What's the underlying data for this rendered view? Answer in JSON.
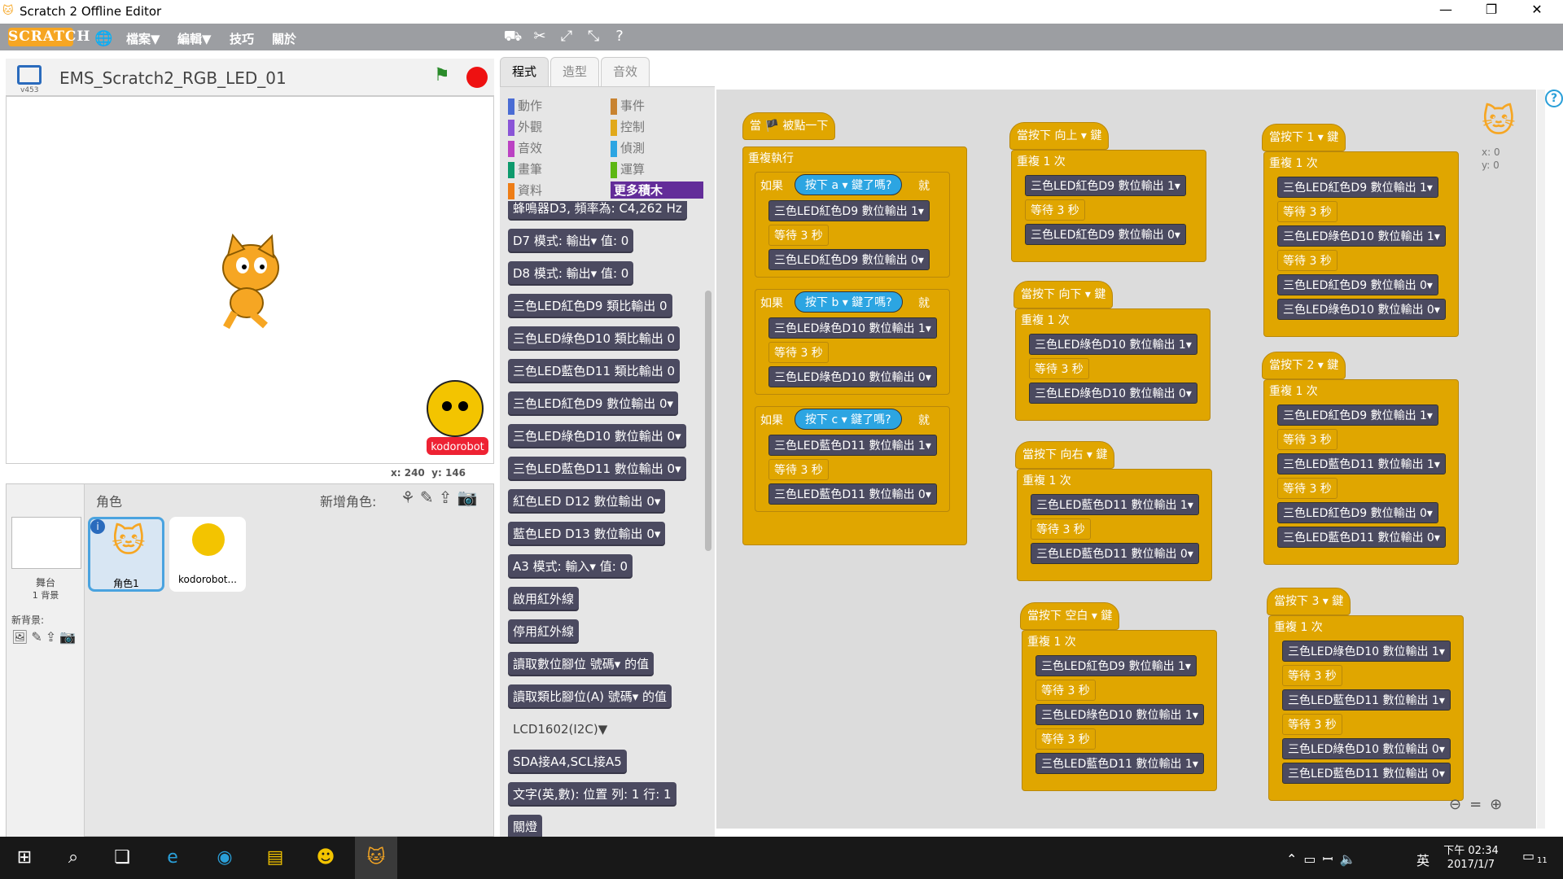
{
  "window": {
    "title": "Scratch 2 Offline Editor"
  },
  "menu": {
    "file": "檔案▼",
    "edit": "編輯▼",
    "tips": "技巧",
    "about": "關於"
  },
  "stage": {
    "project_title": "EMS_Scratch2_RGB_LED_01",
    "version": "v453",
    "x_label": "x:",
    "x": "240",
    "y_label": "y:",
    "y": "146"
  },
  "tabs": {
    "scripts": "程式",
    "costumes": "造型",
    "sounds": "音效"
  },
  "categories": [
    {
      "label": "動作",
      "color": "#4a6cd4"
    },
    {
      "label": "事件",
      "color": "#c88330"
    },
    {
      "label": "外觀",
      "color": "#8a55d7"
    },
    {
      "label": "控制",
      "color": "#e1a91a"
    },
    {
      "label": "音效",
      "color": "#bb42c3"
    },
    {
      "label": "偵測",
      "color": "#2ca5e2"
    },
    {
      "label": "畫筆",
      "color": "#0e9a6c"
    },
    {
      "label": "運算",
      "color": "#5cb712"
    },
    {
      "label": "資料",
      "color": "#ee7d16"
    },
    {
      "label": "更多積木",
      "color": "#632d99"
    }
  ],
  "palette_blocks": [
    "蜂鳴器D3, 頻率為: C4,262 Hz",
    "D7 模式: 輸出▾ 值: 0",
    "D8 模式: 輸出▾ 值: 0",
    "三色LED紅色D9 類比輸出 0",
    "三色LED綠色D10 類比輸出 0",
    "三色LED藍色D11 類比輸出 0",
    "三色LED紅色D9 數位輸出 0▾",
    "三色LED綠色D10 數位輸出 0▾",
    "三色LED藍色D11 數位輸出 0▾",
    "紅色LED D12 數位輸出 0▾",
    "藍色LED D13 數位輸出 0▾",
    "A3 模式: 輸入▾ 值: 0",
    "啟用紅外線",
    "停用紅外線",
    "讀取數位腳位 號碼▾ 的值",
    "讀取類比腳位(A) 號碼▾ 的值",
    "LCD1602(I2C)▼",
    "SDA接A4,SCL接A5",
    "文字(英,數): 位置 列: 1 行: 1",
    "關燈"
  ],
  "sprites": {
    "header": "角色",
    "new_sprite": "新增角色:",
    "stage_label": "舞台",
    "backdrops": "1 背景",
    "new_backdrop": "新背景:",
    "items": [
      {
        "name": "角色1"
      },
      {
        "name": "kodorobot..."
      }
    ]
  },
  "scripts": {
    "main": {
      "hat": "當 🏴 被點一下",
      "forever": "重複執行",
      "if1": "如果",
      "key_a": "按下 a ▾ 鍵了嗎?",
      "then": "就",
      "if_rows_a": [
        "三色LED紅色D9 數位輸出 1▾",
        "等待 3 秒",
        "三色LED紅色D9 數位輸出 0▾"
      ],
      "key_b": "按下 b ▾ 鍵了嗎?",
      "if_rows_b": [
        "三色LED綠色D10 數位輸出 1▾",
        "等待 3 秒",
        "三色LED綠色D10 數位輸出 0▾"
      ],
      "key_c": "按下 c ▾ 鍵了嗎?",
      "if_rows_c": [
        "三色LED藍色D11 數位輸出 1▾",
        "等待 3 秒",
        "三色LED藍色D11 數位輸出 0▾"
      ]
    },
    "col2": [
      {
        "hat": "當按下 向上 ▾ 鍵",
        "repeat": "重複 1 次",
        "rows": [
          "三色LED紅色D9 數位輸出 1▾",
          "等待 3 秒",
          "三色LED紅色D9 數位輸出 0▾"
        ]
      },
      {
        "hat": "當按下 向下 ▾ 鍵",
        "repeat": "重複 1 次",
        "rows": [
          "三色LED綠色D10 數位輸出 1▾",
          "等待 3 秒",
          "三色LED綠色D10 數位輸出 0▾"
        ]
      },
      {
        "hat": "當按下 向右 ▾ 鍵",
        "repeat": "重複 1 次",
        "rows": [
          "三色LED藍色D11 數位輸出 1▾",
          "等待 3 秒",
          "三色LED藍色D11 數位輸出 0▾"
        ]
      },
      {
        "hat": "當按下 空白 ▾ 鍵",
        "repeat": "重複 1 次",
        "rows": [
          "三色LED紅色D9 數位輸出 1▾",
          "等待 3 秒",
          "三色LED綠色D10 數位輸出 1▾",
          "等待 3 秒",
          "三色LED藍色D11 數位輸出 1▾"
        ]
      }
    ],
    "col3": [
      {
        "hat": "當按下 1 ▾ 鍵",
        "repeat": "重複 1 次",
        "rows": [
          "三色LED紅色D9 數位輸出 1▾",
          "等待 3 秒",
          "三色LED綠色D10 數位輸出 1▾",
          "等待 3 秒",
          "三色LED紅色D9 數位輸出 0▾",
          "三色LED綠色D10 數位輸出 0▾"
        ]
      },
      {
        "hat": "當按下 2 ▾ 鍵",
        "repeat": "重複 1 次",
        "rows": [
          "三色LED紅色D9 數位輸出 1▾",
          "等待 3 秒",
          "三色LED藍色D11 數位輸出 1▾",
          "等待 3 秒",
          "三色LED紅色D9 數位輸出 0▾",
          "三色LED藍色D11 數位輸出 0▾"
        ]
      },
      {
        "hat": "當按下 3 ▾ 鍵",
        "repeat": "重複 1 次",
        "rows": [
          "三色LED綠色D10 數位輸出 1▾",
          "等待 3 秒",
          "三色LED藍色D11 數位輸出 1▾",
          "等待 3 秒",
          "三色LED綠色D10 數位輸出 0▾",
          "三色LED藍色D11 數位輸出 0▾"
        ]
      }
    ],
    "sprite_x": "x: 0",
    "sprite_y": "y: 0"
  },
  "taskbar": {
    "time": "下午 02:34",
    "date": "2017/1/7",
    "ime": "英",
    "notif": "11"
  }
}
